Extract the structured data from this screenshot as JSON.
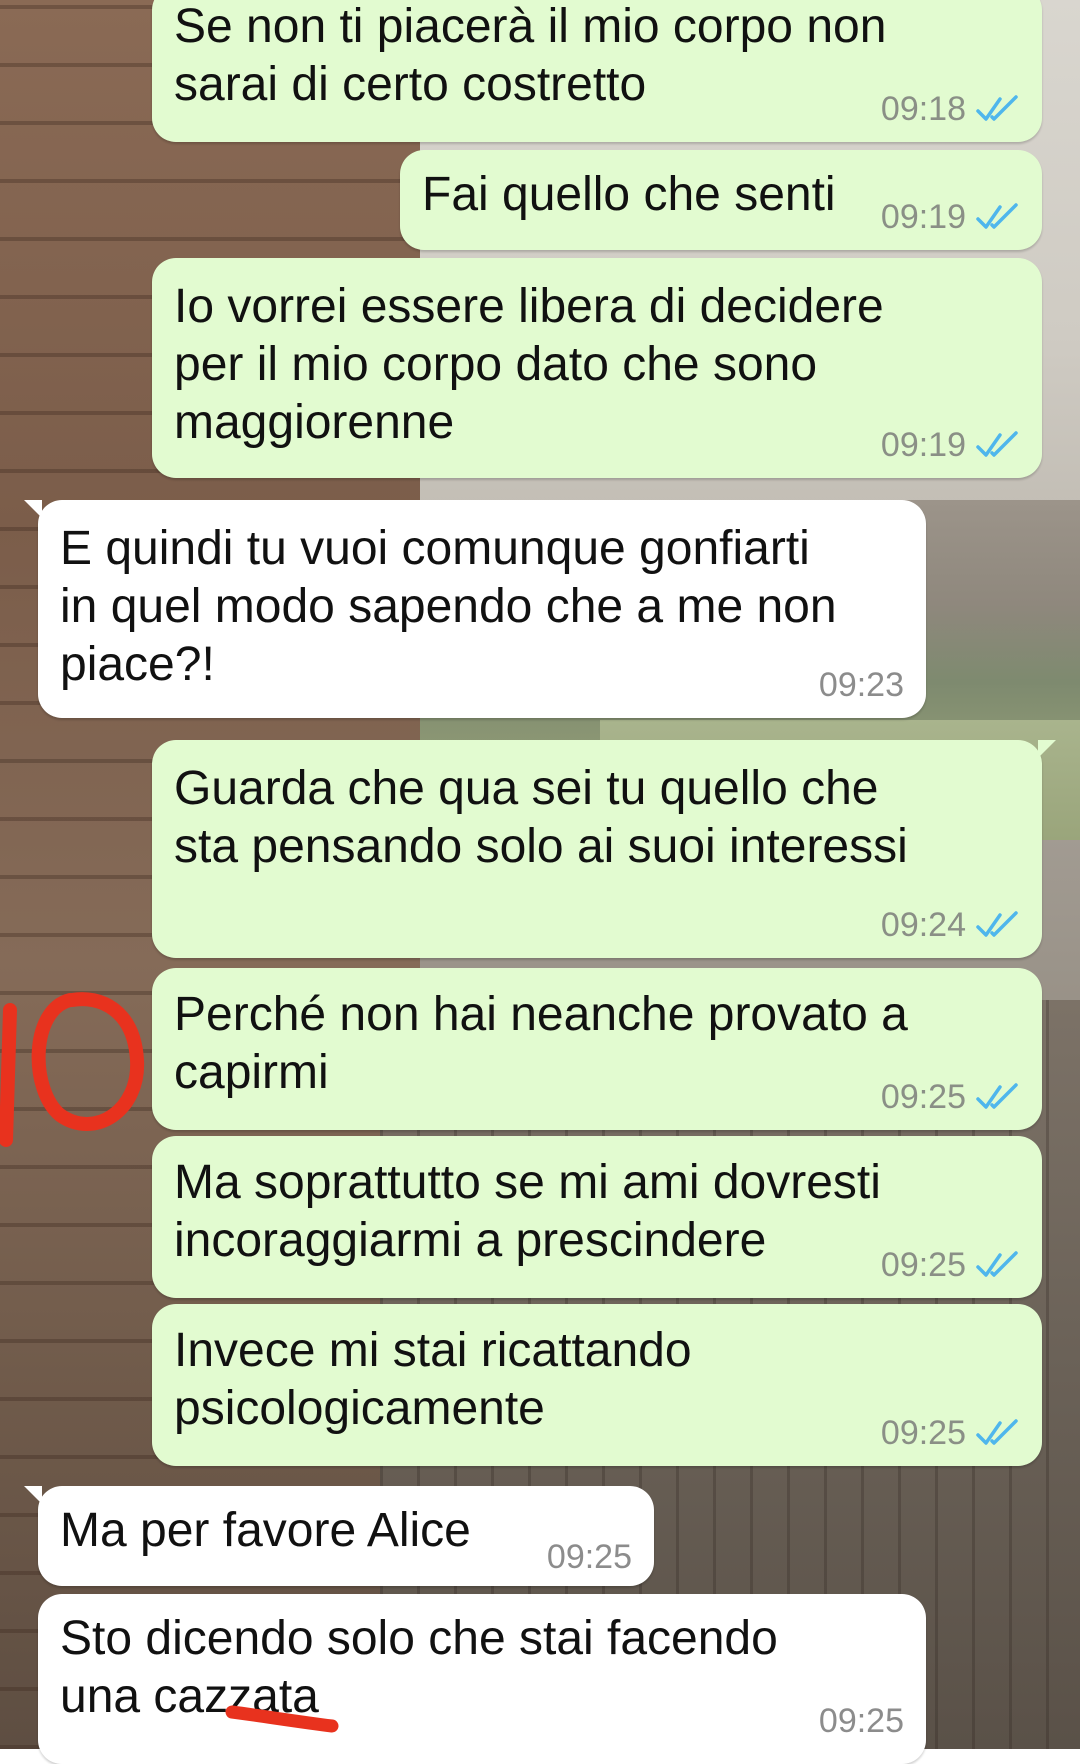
{
  "colors": {
    "outgoing_bubble": "#e2fbd0",
    "incoming_bubble": "#ffffff",
    "read_tick": "#4fb6ec",
    "timestamp": "#8a8f86",
    "annotation_red": "#e8321e"
  },
  "messages": [
    {
      "direction": "out",
      "text": "Se non ti piacerà il mio corpo non\nsarai di certo costretto",
      "time": "09:18",
      "status": "read"
    },
    {
      "direction": "out",
      "text": "Fai quello che senti",
      "time": "09:19",
      "status": "read"
    },
    {
      "direction": "out",
      "text": "Io vorrei essere libera di decidere\nper il  mio corpo dato che sono\nmaggiorenne",
      "time": "09:19",
      "status": "read"
    },
    {
      "direction": "in",
      "text": "E quindi tu vuoi comunque gonfiarti\nin quel modo sapendo che a me non\npiace?!",
      "time": "09:23"
    },
    {
      "direction": "out",
      "text": "Guarda che qua sei tu quello che\nsta pensando solo ai suoi interessi",
      "time": "09:24",
      "status": "read"
    },
    {
      "direction": "out",
      "text": "Perché non hai neanche provato a\ncapirmi",
      "time": "09:25",
      "status": "read"
    },
    {
      "direction": "out",
      "text": "Ma soprattutto se mi ami dovresti\nincoraggiarmi a prescindere",
      "time": "09:25",
      "status": "read"
    },
    {
      "direction": "out",
      "text": "Invece mi stai ricattando\npsicologicamente",
      "time": "09:25",
      "status": "read"
    },
    {
      "direction": "in",
      "text": "Ma per favore Alice",
      "time": "09:25"
    },
    {
      "direction": "in",
      "text": "Sto dicendo solo che stai facendo\nuna cazzata",
      "time": "09:25"
    }
  ],
  "annotations": {
    "handwritten_label": "IO"
  }
}
